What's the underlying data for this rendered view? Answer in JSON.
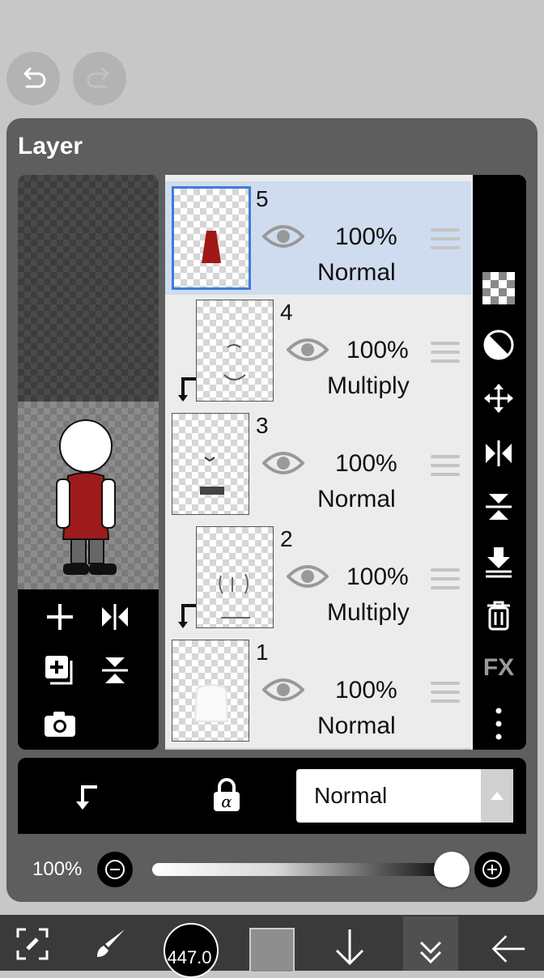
{
  "panel": {
    "title": "Layer"
  },
  "layers": [
    {
      "number": "5",
      "opacity": "100%",
      "blend": "Normal",
      "selected": true,
      "clipped": false
    },
    {
      "number": "4",
      "opacity": "100%",
      "blend": "Multiply",
      "selected": false,
      "clipped": true
    },
    {
      "number": "3",
      "opacity": "100%",
      "blend": "Normal",
      "selected": false,
      "clipped": false
    },
    {
      "number": "2",
      "opacity": "100%",
      "blend": "Multiply",
      "selected": false,
      "clipped": true
    },
    {
      "number": "1",
      "opacity": "100%",
      "blend": "Normal",
      "selected": false,
      "clipped": false
    }
  ],
  "side_tools": [
    "checker-icon",
    "mask-icon",
    "move-icon",
    "flip-horizontal-icon",
    "flip-vertical-icon",
    "merge-down-icon",
    "trash-icon",
    "fx-icon",
    "more-icon"
  ],
  "fx_label": "FX",
  "blend_select": {
    "value": "Normal"
  },
  "opacity_slider": {
    "label": "100%",
    "value": 1.0
  },
  "bottom_toolbar": {
    "brush_size": "447.0"
  },
  "colors": {
    "accent": "#3d7bd9",
    "selected_row": "#cfdcef",
    "panel": "#5e5e5e"
  }
}
